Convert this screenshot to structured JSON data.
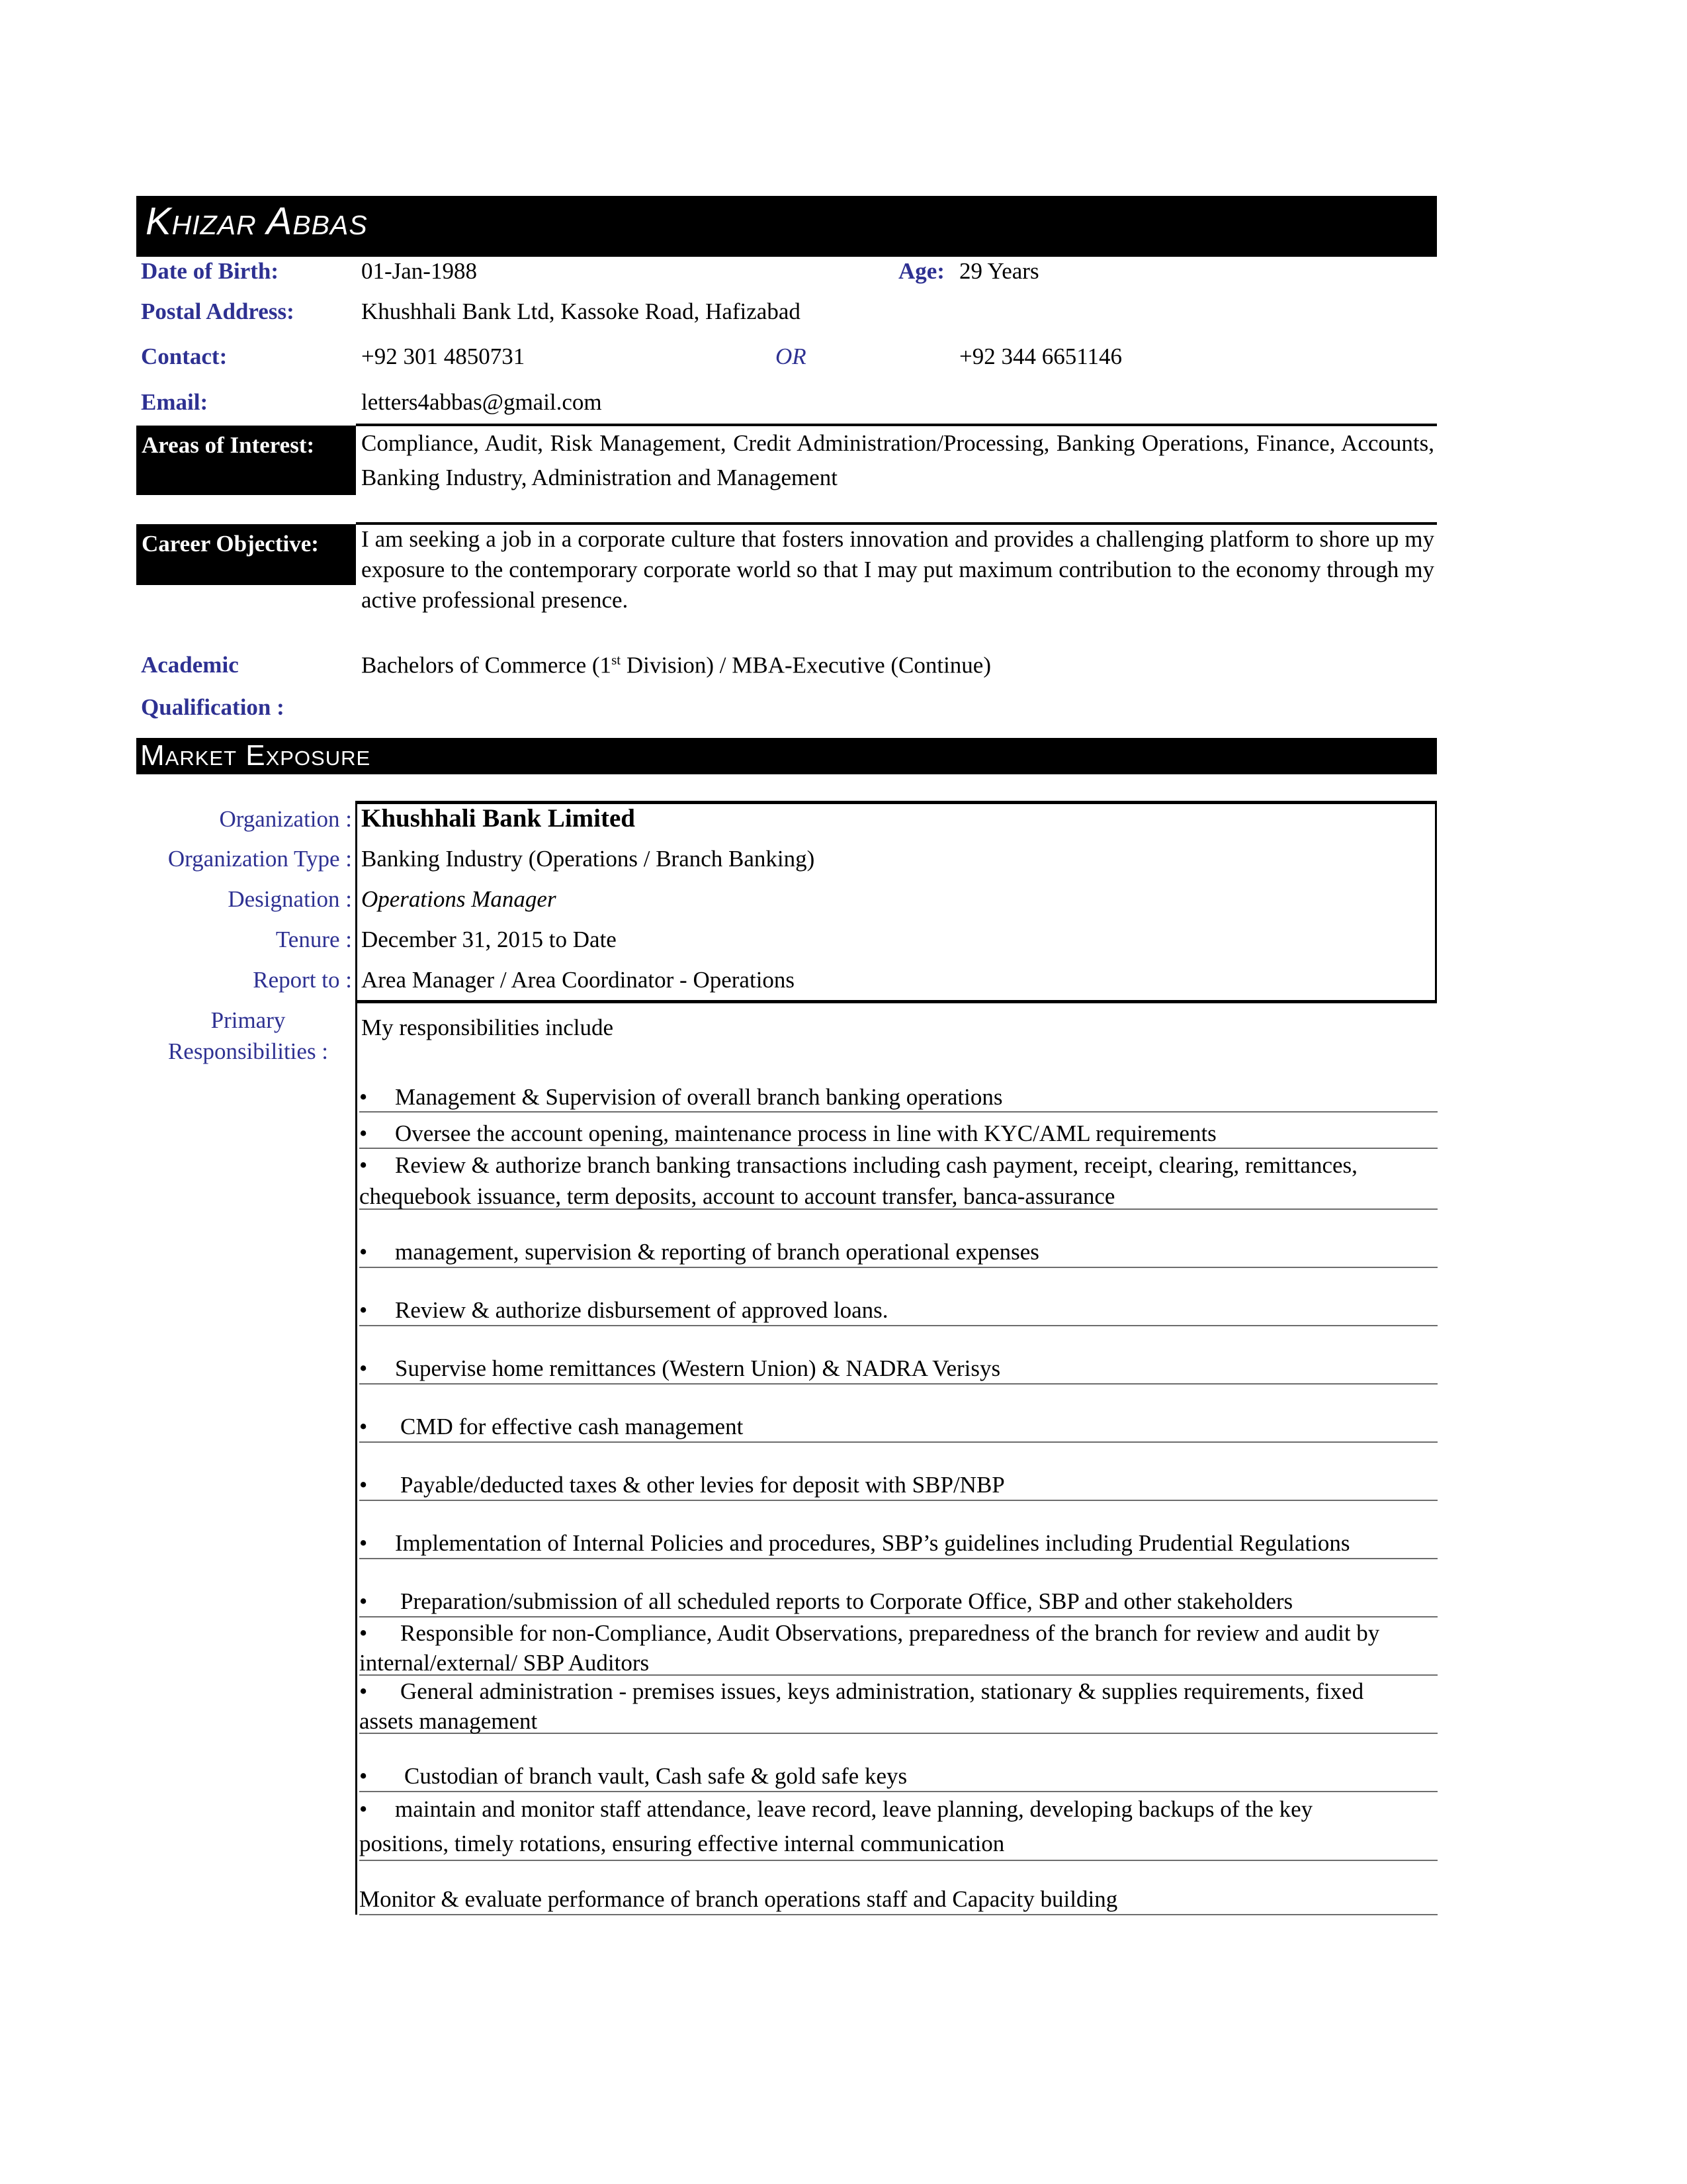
{
  "header": {
    "name": "Khizar Abbas"
  },
  "personal": {
    "dob_label": "Date of Birth:",
    "dob_value": "01-Jan-1988",
    "age_label": "Age:",
    "age_value": "29 Years",
    "postal_label": "Postal Address:",
    "postal_value": "Khushhali Bank Ltd, Kassoke Road, Hafizabad",
    "contact_label": "Contact:",
    "contact_primary": "+92 301 4850731",
    "contact_or": "OR",
    "contact_secondary": "+92 344 6651146",
    "email_label": "Email:",
    "email_value": "letters4abbas@gmail.com"
  },
  "areas_of_interest": {
    "label": "Areas of Interest:",
    "text": "Compliance, Audit, Risk Management, Credit Administration/Processing, Banking Operations, Finance, Accounts, Banking Industry, Administration and Management"
  },
  "career_objective": {
    "label": "Career Objective:",
    "text": "I am seeking a job in a corporate culture that fosters innovation and provides a challenging platform to shore up my exposure to the contemporary corporate world so that I may put maximum contribution to the economy through my active professional presence."
  },
  "academic": {
    "label_line1": "Academic",
    "label_line2": "Qualification :",
    "text_before": "Bachelors of Commerce (1",
    "superscript": "st",
    "text_after": " Division) / MBA-Executive (Continue)"
  },
  "market_exposure": {
    "title": "Market Exposure",
    "organization_label": "Organization :",
    "organization_value": "Khushhali Bank Limited",
    "org_type_label": "Organization Type :",
    "org_type_value": "Banking Industry (Operations / Branch Banking)",
    "designation_label": "Designation :",
    "designation_value": "Operations Manager",
    "tenure_label": "Tenure :",
    "tenure_value": "December 31, 2015 to Date",
    "report_label": "Report to :",
    "report_value": "Area Manager / Area Coordinator - Operations",
    "responsibilities_label_line1": "Primary",
    "responsibilities_label_line2": "Responsibilities :",
    "responsibilities_intro": "My responsibilities  include",
    "bullet": "•",
    "responsibilities": [
      "Management & Supervision of overall branch banking operations",
      "Oversee the account opening, maintenance process in line with KYC/AML requirements",
      "Review & authorize branch banking transactions including cash payment, receipt, clearing, remittances,",
      "chequebook issuance, term deposits, account to account transfer, banca-assurance",
      "management, supervision & reporting of branch operational expenses",
      "Review & authorize disbursement of approved loans.",
      "Supervise home remittances (Western Union) & NADRA Verisys",
      "CMD for effective cash management",
      "Payable/deducted taxes & other levies for deposit with SBP/NBP",
      "Implementation of Internal Policies and procedures, SBP’s guidelines including Prudential Regulations",
      "Preparation/submission of all scheduled reports to Corporate Office, SBP and other stakeholders",
      "Responsible for non-Compliance, Audit Observations, preparedness of the branch for review and audit by",
      "internal/external/ SBP Auditors",
      "General administration - premises issues, keys administration, stationary & supplies requirements, fixed",
      "assets management",
      "Custodian of branch vault, Cash safe & gold safe keys",
      "maintain and monitor staff attendance, leave record, leave planning, developing backups of the key",
      "positions, timely rotations, ensuring effective internal communication",
      "Monitor & evaluate performance of branch operations staff  and Capacity building"
    ]
  },
  "colors": {
    "label_blue": "#2e3192",
    "bar_black": "#000000",
    "row_line_gray": "#6d6d6d"
  }
}
